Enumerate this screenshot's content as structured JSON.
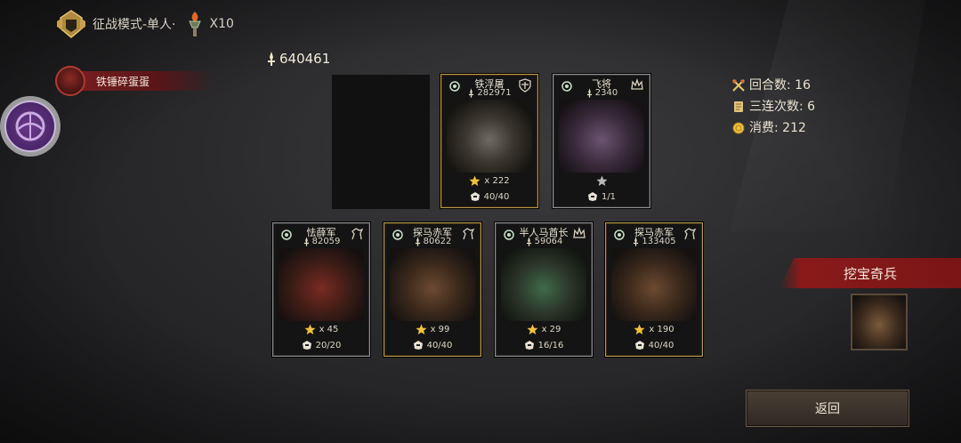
{
  "header": {
    "mode_label": "征战模式-单人·",
    "multiplier": "X10"
  },
  "player": {
    "name": "铁锤碎蛋蛋"
  },
  "total_power": "640461",
  "top_cards": [
    {
      "empty": true
    },
    {
      "name": "铁浮屠",
      "power": "282971",
      "stars": "x 222",
      "troops": "40/40",
      "frame": "gold",
      "art": "art-gold"
    },
    {
      "name": "飞将",
      "power": "2340",
      "stars": "",
      "troops": "1/1",
      "frame": "silver",
      "art": "art-purple"
    }
  ],
  "bottom_cards": [
    {
      "name": "怯薛军",
      "power": "82059",
      "stars": "x 45",
      "troops": "20/20",
      "frame": "silver",
      "art": "art-red"
    },
    {
      "name": "探马赤军",
      "power": "80622",
      "stars": "x 99",
      "troops": "40/40",
      "frame": "gold",
      "art": "art-brown"
    },
    {
      "name": "半人马酋长",
      "power": "59064",
      "stars": "x 29",
      "troops": "16/16",
      "frame": "silver",
      "art": "art-green"
    },
    {
      "name": "探马赤军",
      "power": "133405",
      "stars": "x 190",
      "troops": "40/40",
      "frame": "gold",
      "art": "art-brown"
    }
  ],
  "stats": {
    "rounds": "回合数: 16",
    "combo": "三连次数: 6",
    "cost": "消费: 212"
  },
  "treasure": {
    "title": "挖宝奇兵"
  },
  "back_label": "返回",
  "colors": {
    "gold_frame": "#b89a4c",
    "banner_red": "#8a1a1a",
    "text": "#e6e0d4"
  },
  "icons": [
    "helmet-icon",
    "torch-icon",
    "sword-icon",
    "star-icon",
    "axes-icon",
    "scroll-icon",
    "coin-icon",
    "target-icon"
  ]
}
